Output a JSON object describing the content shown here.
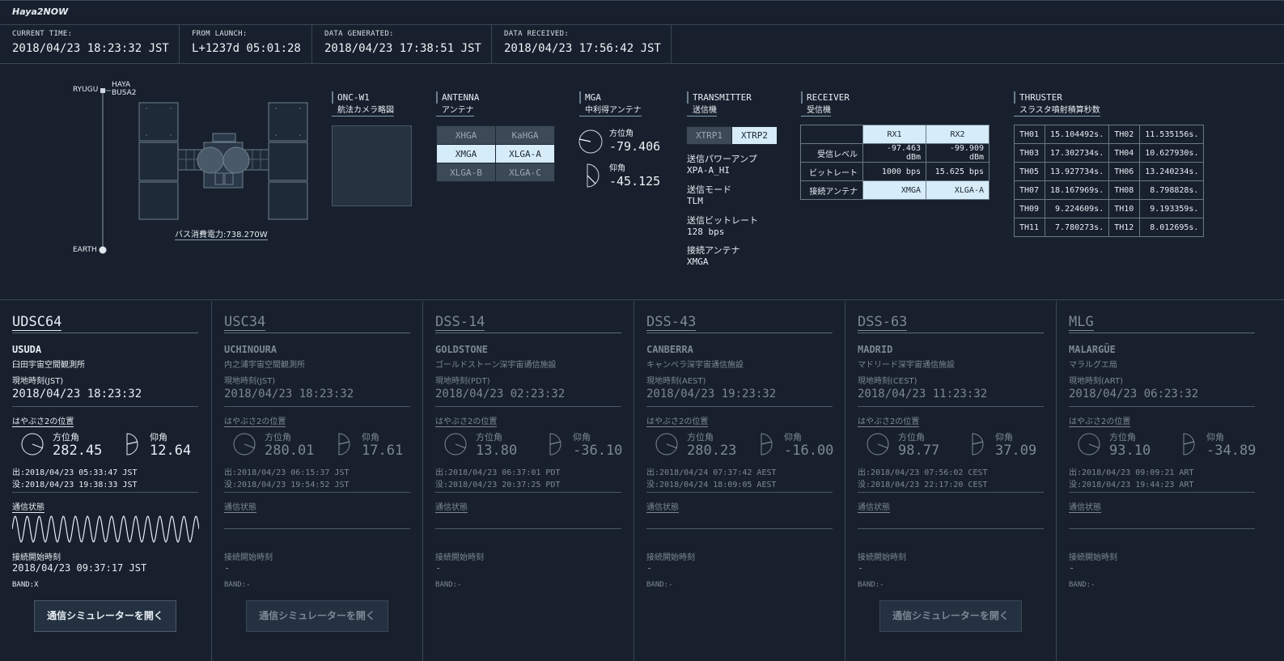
{
  "app_title": "Haya2NOW",
  "times": [
    {
      "label": "CURRENT TIME:",
      "value": "2018/04/23 18:23:32 JST"
    },
    {
      "label": "FROM LAUNCH:",
      "value": "L+1237d 05:01:28"
    },
    {
      "label": "DATA GENERATED:",
      "value": "2018/04/23 17:38:51 JST"
    },
    {
      "label": "DATA RECEIVED:",
      "value": "2018/04/23 17:56:42 JST"
    }
  ],
  "spacecraft": {
    "ryugu": "RYUGU",
    "haya": "HAYA",
    "busa2": "BUSA2",
    "earth": "EARTH",
    "power": "バス消費電力:738.270W"
  },
  "onc": {
    "en": "ONC-W1",
    "jp": "航法カメラ略図"
  },
  "antenna": {
    "en": "ANTENNA",
    "jp": "アンテナ",
    "cells": [
      [
        "XHGA",
        "KaHGA"
      ],
      [
        "XMGA",
        "XLGA-A"
      ],
      [
        "XLGA-B",
        "XLGA-C"
      ]
    ]
  },
  "mga": {
    "en": "MGA",
    "jp": "中利得アンテナ",
    "az_label": "方位角",
    "az": "-79.406",
    "el_label": "仰角",
    "el": "-45.125"
  },
  "transmitter": {
    "en": "TRANSMITTER",
    "jp": "送信機",
    "xtrp": [
      "XTRP1",
      "XTRP2"
    ],
    "items": [
      {
        "k": "送信パワーアンプ",
        "v": "XPA-A_HI"
      },
      {
        "k": "送信モード",
        "v": "TLM"
      },
      {
        "k": "送信ビットレート",
        "v": "128 bps"
      },
      {
        "k": "接続アンテナ",
        "v": "XMGA"
      }
    ]
  },
  "receiver": {
    "en": "RECEIVER",
    "jp": "受信機",
    "h1": "RX1",
    "h2": "RX2",
    "rows": [
      {
        "k": "受信レベル",
        "a": "-97.463 dBm",
        "b": "-99.909 dBm"
      },
      {
        "k": "ビットレート",
        "a": "1000 bps",
        "b": "15.625 bps"
      },
      {
        "k": "接続アンテナ",
        "a": "XMGA",
        "b": "XLGA-A"
      }
    ]
  },
  "thruster": {
    "en": "THRUSTER",
    "jp": "スラスタ噴射積算秒数",
    "rows": [
      [
        "TH01",
        "15.104492s.",
        "TH02",
        "11.535156s."
      ],
      [
        "TH03",
        "17.302734s.",
        "TH04",
        "10.627930s."
      ],
      [
        "TH05",
        "13.927734s.",
        "TH06",
        "13.240234s."
      ],
      [
        "TH07",
        "18.167969s.",
        "TH08",
        "8.798828s."
      ],
      [
        "TH09",
        "9.224609s.",
        "TH10",
        "9.193359s."
      ],
      [
        "TH11",
        "7.780273s.",
        "TH12",
        "8.012695s."
      ]
    ]
  },
  "labels": {
    "local_time": "現地時刻",
    "position": "はやぶさ2の位置",
    "az": "方位角",
    "el": "仰角",
    "comm": "通信状態",
    "conn_start": "接続開始時刻",
    "button": "通信シミュレーターを開く"
  },
  "stations": [
    {
      "code": "UDSC64",
      "city": "USUDA",
      "jname": "臼田宇宙空間観測所",
      "tz": "現地時刻(JST)",
      "time": "2018/04/23 18:23:32",
      "az": "282.45",
      "el": "12.64",
      "rise": "出:2018/04/23 05:33:47 JST",
      "set": "没:2018/04/23 19:38:33 JST",
      "conn": "2018/04/23 09:37:17 JST",
      "band": "BAND:X",
      "active": true,
      "button": true
    },
    {
      "code": "USC34",
      "city": "UCHINOURA",
      "jname": "内之浦宇宙空間観測所",
      "tz": "現地時刻(JST)",
      "time": "2018/04/23 18:23:32",
      "az": "280.01",
      "el": "17.61",
      "rise": "出:2018/04/23 06:15:37 JST",
      "set": "没:2018/04/23 19:54:52 JST",
      "conn": "-",
      "band": "BAND:-",
      "active": false,
      "button": true
    },
    {
      "code": "DSS-14",
      "city": "GOLDSTONE",
      "jname": "ゴールドストーン深宇宙通信施設",
      "tz": "現地時刻(PDT)",
      "time": "2018/04/23 02:23:32",
      "az": "13.80",
      "el": "-36.10",
      "rise": "出:2018/04/23 06:37:01 PDT",
      "set": "没:2018/04/23 20:37:25 PDT",
      "conn": "-",
      "band": "BAND:-",
      "active": false,
      "button": false
    },
    {
      "code": "DSS-43",
      "city": "CANBERRA",
      "jname": "キャンベラ深宇宙通信施設",
      "tz": "現地時刻(AEST)",
      "time": "2018/04/23 19:23:32",
      "az": "280.23",
      "el": "-16.00",
      "rise": "出:2018/04/24 07:37:42 AEST",
      "set": "没:2018/04/24 18:09:05 AEST",
      "conn": "-",
      "band": "BAND:-",
      "active": false,
      "button": false
    },
    {
      "code": "DSS-63",
      "city": "MADRID",
      "jname": "マドリード深宇宙通信施設",
      "tz": "現地時刻(CEST)",
      "time": "2018/04/23 11:23:32",
      "az": "98.77",
      "el": "37.09",
      "rise": "出:2018/04/23 07:56:02 CEST",
      "set": "没:2018/04/23 22:17:20 CEST",
      "conn": "-",
      "band": "BAND:-",
      "active": false,
      "button": true
    },
    {
      "code": "MLG",
      "city": "MALARGÜE",
      "jname": "マラルグエ局",
      "tz": "現地時刻(ART)",
      "time": "2018/04/23 06:23:32",
      "az": "93.10",
      "el": "-34.89",
      "rise": "出:2018/04/23 09:09:21 ART",
      "set": "没:2018/04/23 19:44:23 ART",
      "conn": "-",
      "band": "BAND:-",
      "active": false,
      "button": false
    }
  ],
  "colors": {
    "background": "#17202c",
    "highlight": "#d6ecf8",
    "dim_text": "#7d8894"
  }
}
